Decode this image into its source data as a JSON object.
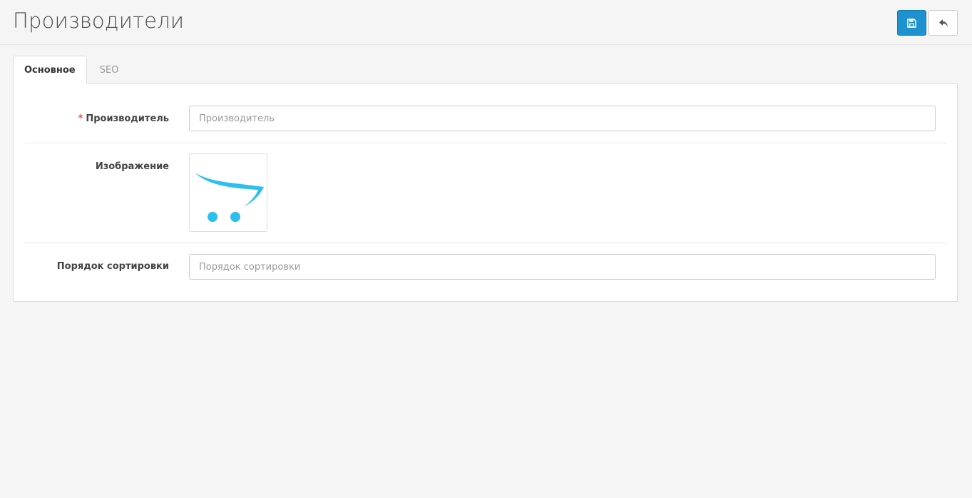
{
  "header": {
    "title": "Производители",
    "save_icon": "save-icon",
    "back_icon": "reply-icon",
    "primary_color": "#1e91cf"
  },
  "tabs": [
    {
      "label": "Основное",
      "active": true
    },
    {
      "label": "SEO",
      "active": false
    }
  ],
  "form": {
    "manufacturer": {
      "required_mark": "*",
      "label": "Производитель",
      "value": "",
      "placeholder": "Производитель"
    },
    "image": {
      "label": "Изображение",
      "icon": "cart-placeholder-icon",
      "icon_color": "#2bbfef"
    },
    "sort_order": {
      "label": "Порядок сортировки",
      "value": "",
      "placeholder": "Порядок сортировки"
    }
  }
}
